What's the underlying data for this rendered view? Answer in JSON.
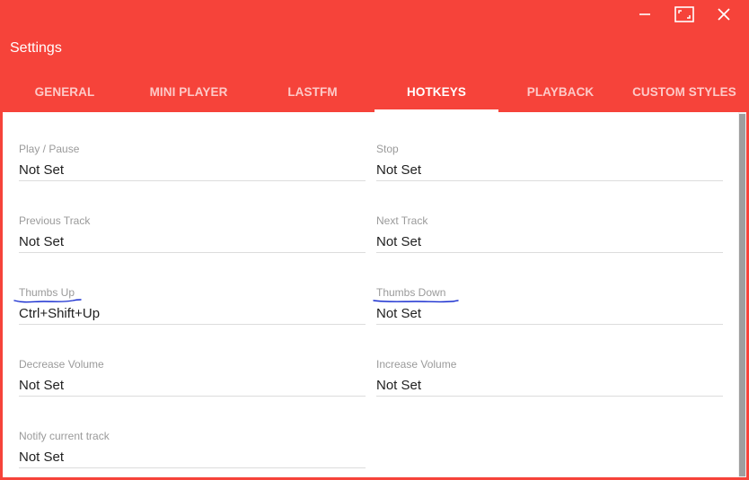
{
  "window": {
    "title": "Settings",
    "controls": {
      "minimize": "minimize-icon",
      "maximize": "maximize-icon",
      "close": "close-icon"
    }
  },
  "tabs": [
    {
      "label": "GENERAL",
      "active": false
    },
    {
      "label": "MINI PLAYER",
      "active": false
    },
    {
      "label": "LASTFM",
      "active": false
    },
    {
      "label": "HOTKEYS",
      "active": true
    },
    {
      "label": "PLAYBACK",
      "active": false
    },
    {
      "label": "CUSTOM STYLES",
      "active": false
    }
  ],
  "hotkeys": {
    "play_pause": {
      "label": "Play / Pause",
      "value": "Not Set"
    },
    "stop": {
      "label": "Stop",
      "value": "Not Set"
    },
    "previous_track": {
      "label": "Previous Track",
      "value": "Not Set"
    },
    "next_track": {
      "label": "Next Track",
      "value": "Not Set"
    },
    "thumbs_up": {
      "label": "Thumbs Up",
      "value": "Ctrl+Shift+Up"
    },
    "thumbs_down": {
      "label": "Thumbs Down",
      "value": "Not Set"
    },
    "decrease_volume": {
      "label": "Decrease Volume",
      "value": "Not Set"
    },
    "increase_volume": {
      "label": "Increase Volume",
      "value": "Not Set"
    },
    "notify_current_track": {
      "label": "Notify current track",
      "value": "Not Set"
    }
  },
  "colors": {
    "accent": "#f6433a",
    "tab_text_inactive": "#ffffffb8",
    "label": "#9a9a9a",
    "value": "#212121",
    "underline": "#dcdcdc",
    "annotation": "#1a2fd0"
  }
}
